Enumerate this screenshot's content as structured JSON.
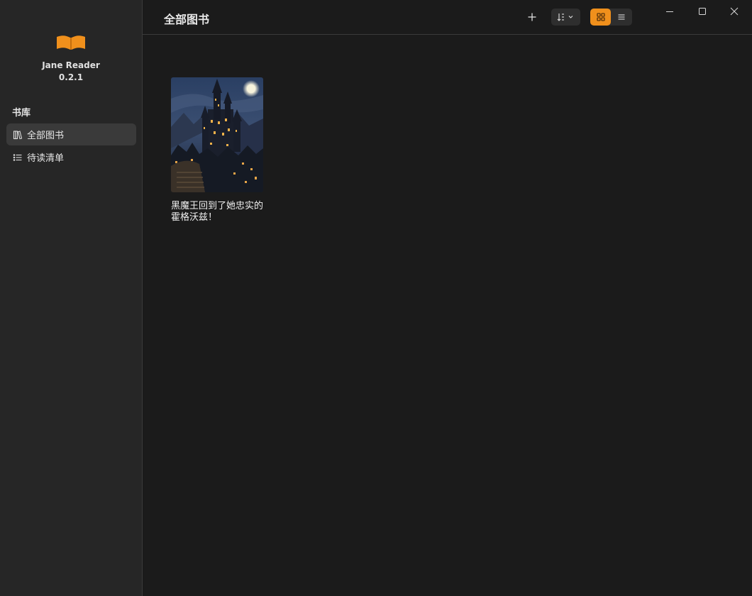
{
  "app": {
    "name": "Jane Reader",
    "version": "0.2.1",
    "accent_color": "#f0901c"
  },
  "sidebar": {
    "section_label": "书库",
    "items": [
      {
        "label": "全部图书",
        "icon": "bookshelf-icon",
        "active": true
      },
      {
        "label": "待读清单",
        "icon": "list-icon",
        "active": false
      }
    ]
  },
  "header": {
    "title": "全部图书",
    "add_icon": "plus-icon",
    "sort_icon": "sort-icon",
    "view_modes": [
      {
        "name": "grid",
        "icon": "grid-icon",
        "active": true
      },
      {
        "name": "list",
        "icon": "list-icon",
        "active": false
      }
    ]
  },
  "window_controls": [
    "minimize-icon",
    "maximize-icon",
    "close-icon"
  ],
  "books": [
    {
      "title": "黑魔王回到了她忠实的霍格沃兹！",
      "cover_icon": "dark-castle-cover"
    }
  ]
}
